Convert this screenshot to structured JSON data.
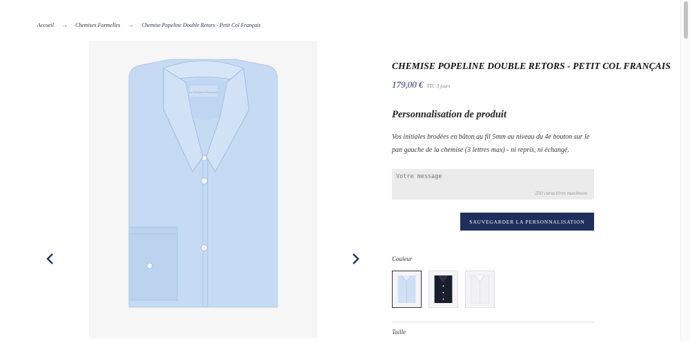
{
  "breadcrumb": {
    "home": "Accueil",
    "category": "Chemises Formelles",
    "current": "Chemise Popeline Double Retors - Petit Col Français",
    "separator": "→"
  },
  "gallery": {
    "shirt_label_text": "La Chemise Française",
    "prev_icon": "chevron-left-icon",
    "next_icon": "chevron-right-icon"
  },
  "product": {
    "title": "CHEMISE POPELINE DOUBLE RETORS - PETIT COL FRANÇAIS",
    "price": "179,00 €",
    "price_note": "TTC 3 jours"
  },
  "customization": {
    "heading": "Personnalisation de produit",
    "description": "Vos initiales brodées en bâton au fil 5mm au niveau du 4e bouton sur le pan gauche de la chemise (3 lettres max) - ni repris, ni échangé.",
    "input_placeholder": "Votre message",
    "input_hint": "250 caractères maximum",
    "save_label": "SAUVEGARDER LA PERSONNALISATION"
  },
  "color": {
    "label": "Couleur",
    "swatches": [
      {
        "name": "light-blue",
        "color": "#cfe0f5",
        "selected": true
      },
      {
        "name": "navy",
        "color": "#1a1d2b",
        "selected": false
      },
      {
        "name": "white",
        "color": "#f1f1f3",
        "selected": false
      }
    ]
  },
  "size": {
    "label": "Taille"
  },
  "colors": {
    "accent": "#1f2f5c",
    "shirt": "#c6dbf3",
    "input_bg": "#ebebeb"
  }
}
